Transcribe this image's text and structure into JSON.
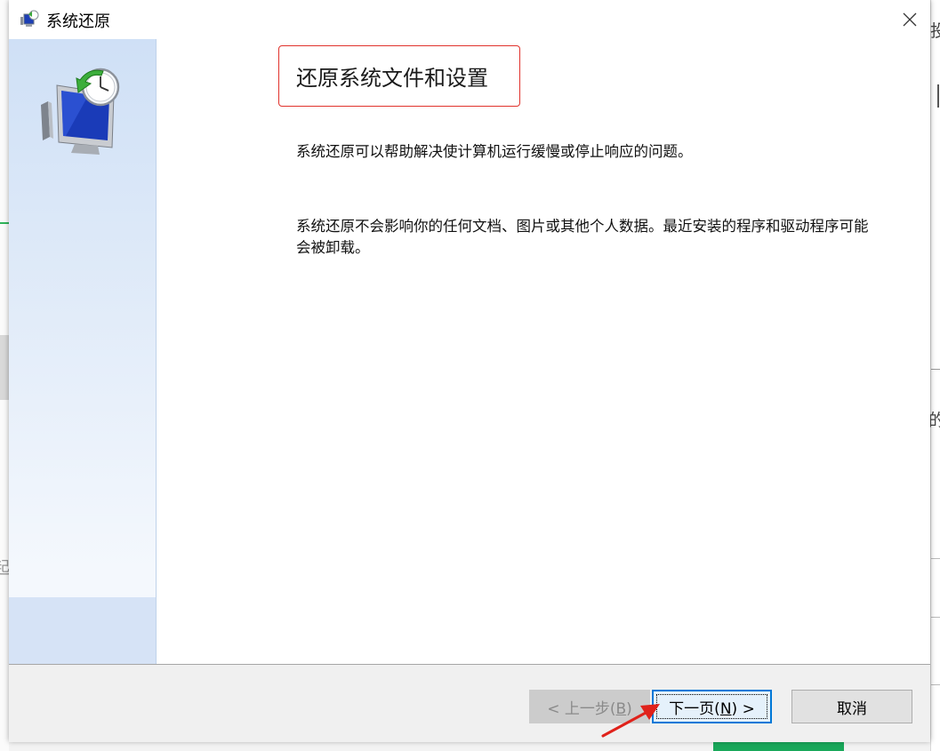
{
  "window": {
    "title": "系统还原",
    "close_label": "×"
  },
  "content": {
    "heading": "还原系统文件和设置",
    "paragraph1": "系统还原可以帮助解决使计算机运行缓慢或停止响应的问题。",
    "paragraph2": "系统还原不会影响你的任何文档、图片或其他个人数据。最近安装的程序和驱动程序可能会被卸载。"
  },
  "buttons": {
    "back": {
      "prefix": "< 上一步(",
      "key": "B",
      "suffix": ")",
      "enabled": false
    },
    "next": {
      "prefix": "下一页(",
      "key": "N",
      "suffix": ") >",
      "enabled": true
    },
    "cancel": {
      "label": "取消"
    }
  },
  "background": {
    "right_glyph_top": "投",
    "right_glyph_mid": "的",
    "left_glyph": "起"
  },
  "colors": {
    "highlight_red": "#e0322c",
    "focus_blue": "#0078d7",
    "sidebar_blue": "#dbe7f8"
  },
  "icons": {
    "title": "system-restore-icon",
    "sidebar": "system-restore-monitor-clock-icon",
    "annotation": "red-arrow-icon"
  }
}
